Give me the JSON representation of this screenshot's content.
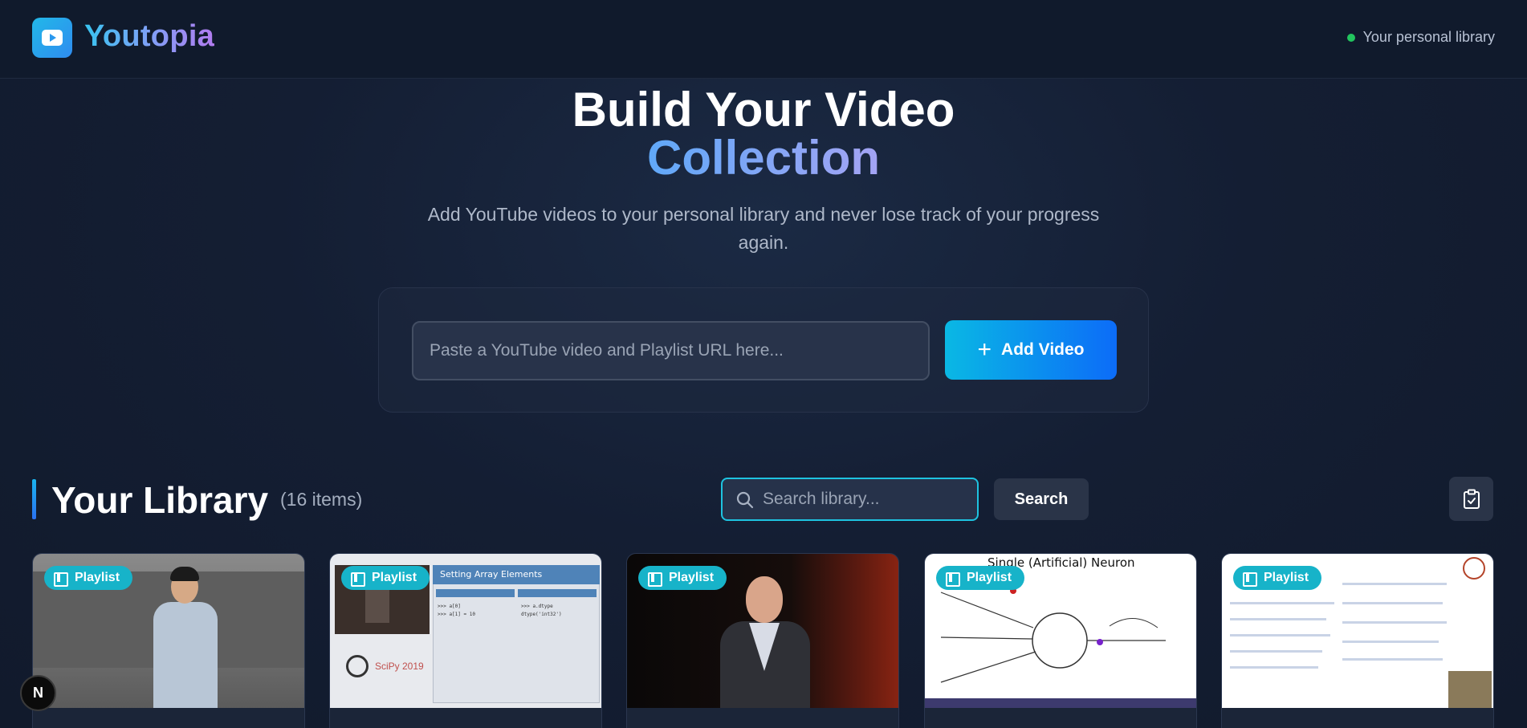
{
  "header": {
    "brand": "Youtopia",
    "status_text": "Your personal library",
    "status_color": "#22c55e"
  },
  "hero": {
    "title_line1": "Build Your Video",
    "title_line2": "Collection",
    "subtitle": "Add YouTube videos to your personal library and never lose track of your progress again."
  },
  "add_form": {
    "url_placeholder": "Paste a YouTube video and Playlist URL here...",
    "url_value": "",
    "add_button_label": "Add Video",
    "add_button_icon": "plus-icon"
  },
  "library": {
    "title": "Your Library",
    "count_text": "(16 items)",
    "search_placeholder": "Search library...",
    "search_value": "",
    "search_button_label": "Search",
    "clipboard_icon": "clipboard-check-icon",
    "cards": [
      {
        "badge": "Playlist"
      },
      {
        "badge": "Playlist",
        "thumb_title": "Setting Array Elements",
        "thumb_logo_text": "SciPy 2019"
      },
      {
        "badge": "Playlist"
      },
      {
        "badge": "Playlist",
        "thumb_title": "Single (Artificial) Neuron"
      },
      {
        "badge": "Playlist"
      }
    ]
  },
  "dev_badge": "N"
}
